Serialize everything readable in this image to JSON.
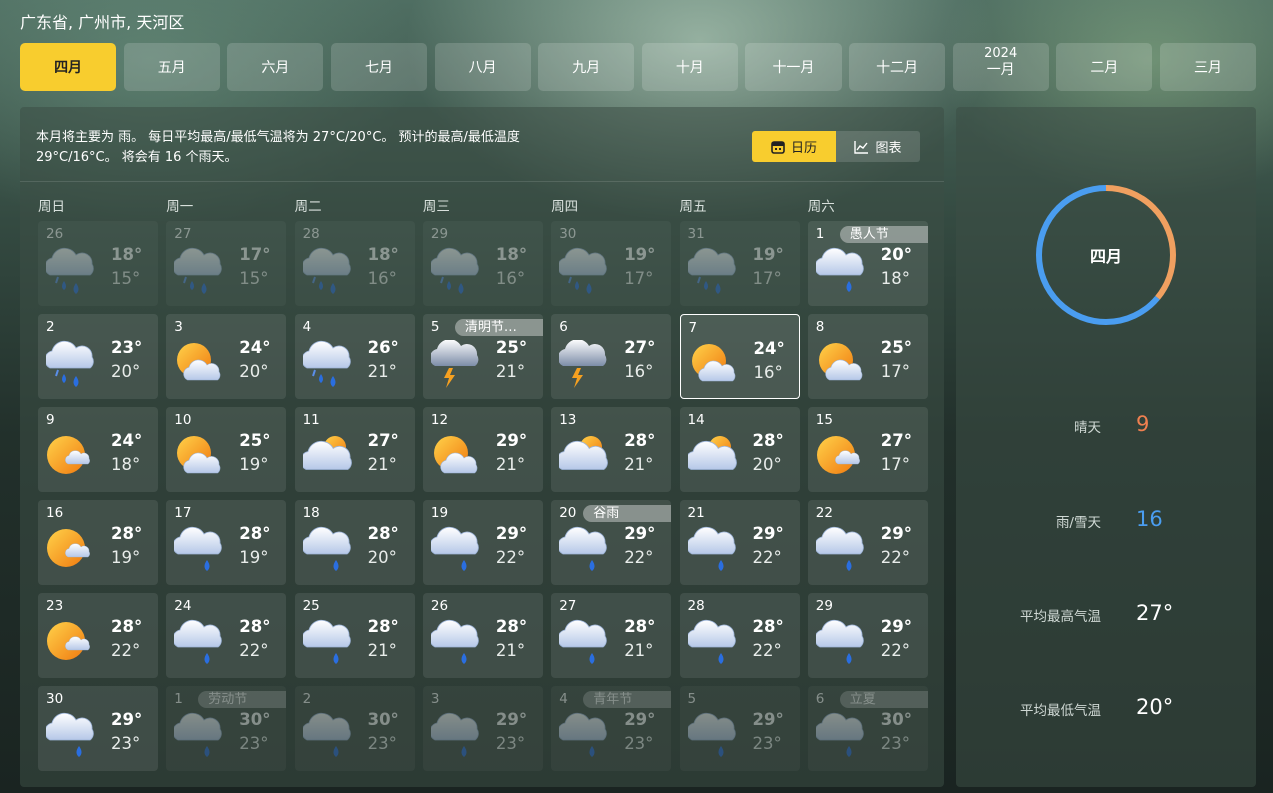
{
  "location": "广东省, 广州市, 天河区",
  "months": [
    {
      "label": "四月",
      "active": true
    },
    {
      "label": "五月"
    },
    {
      "label": "六月"
    },
    {
      "label": "七月"
    },
    {
      "label": "八月"
    },
    {
      "label": "九月"
    },
    {
      "label": "十月"
    },
    {
      "label": "十一月"
    },
    {
      "label": "十二月"
    },
    {
      "label": "一月",
      "year": "2024"
    },
    {
      "label": "二月"
    },
    {
      "label": "三月"
    }
  ],
  "summary": {
    "line1": "本月将主要为 雨。 每日平均最高/最低气温将为 27°C/20°C。 预计的最高/最低温度",
    "line2": "29°C/16°C。 将会有 16 个雨天。"
  },
  "view_toggle": {
    "calendar": "日历",
    "chart": "图表"
  },
  "weekdays": [
    "周日",
    "周一",
    "周二",
    "周三",
    "周四",
    "周五",
    "周六"
  ],
  "days": [
    {
      "d": "26",
      "hi": "18°",
      "lo": "15°",
      "icon": "rain-heavy",
      "faded": true
    },
    {
      "d": "27",
      "hi": "17°",
      "lo": "15°",
      "icon": "rain-heavy",
      "faded": true
    },
    {
      "d": "28",
      "hi": "18°",
      "lo": "16°",
      "icon": "rain-heavy",
      "faded": true
    },
    {
      "d": "29",
      "hi": "18°",
      "lo": "16°",
      "icon": "rain-heavy",
      "faded": true
    },
    {
      "d": "30",
      "hi": "19°",
      "lo": "17°",
      "icon": "rain-heavy",
      "faded": true
    },
    {
      "d": "31",
      "hi": "19°",
      "lo": "17°",
      "icon": "rain-heavy",
      "faded": true
    },
    {
      "d": "1",
      "hi": "20°",
      "lo": "18°",
      "icon": "rain",
      "holiday": "愚人节"
    },
    {
      "d": "2",
      "hi": "23°",
      "lo": "20°",
      "icon": "rain-heavy"
    },
    {
      "d": "3",
      "hi": "24°",
      "lo": "20°",
      "icon": "sun-cloud"
    },
    {
      "d": "4",
      "hi": "26°",
      "lo": "21°",
      "icon": "rain-heavy"
    },
    {
      "d": "5",
      "hi": "25°",
      "lo": "21°",
      "icon": "thunder",
      "holiday": "清明节…"
    },
    {
      "d": "6",
      "hi": "27°",
      "lo": "16°",
      "icon": "thunder"
    },
    {
      "d": "7",
      "hi": "24°",
      "lo": "16°",
      "icon": "sun-cloud",
      "today": true
    },
    {
      "d": "8",
      "hi": "25°",
      "lo": "17°",
      "icon": "sun-cloud"
    },
    {
      "d": "9",
      "hi": "24°",
      "lo": "18°",
      "icon": "sun-small-cloud"
    },
    {
      "d": "10",
      "hi": "25°",
      "lo": "19°",
      "icon": "sun-cloud"
    },
    {
      "d": "11",
      "hi": "27°",
      "lo": "21°",
      "icon": "cloud-sun"
    },
    {
      "d": "12",
      "hi": "29°",
      "lo": "21°",
      "icon": "sun-cloud"
    },
    {
      "d": "13",
      "hi": "28°",
      "lo": "21°",
      "icon": "cloud-sun"
    },
    {
      "d": "14",
      "hi": "28°",
      "lo": "20°",
      "icon": "cloud-sun"
    },
    {
      "d": "15",
      "hi": "27°",
      "lo": "17°",
      "icon": "sun-small-cloud"
    },
    {
      "d": "16",
      "hi": "28°",
      "lo": "19°",
      "icon": "sun-small-cloud"
    },
    {
      "d": "17",
      "hi": "28°",
      "lo": "19°",
      "icon": "rain"
    },
    {
      "d": "18",
      "hi": "28°",
      "lo": "20°",
      "icon": "rain"
    },
    {
      "d": "19",
      "hi": "29°",
      "lo": "22°",
      "icon": "rain"
    },
    {
      "d": "20",
      "hi": "29°",
      "lo": "22°",
      "icon": "rain",
      "holiday": "谷雨"
    },
    {
      "d": "21",
      "hi": "29°",
      "lo": "22°",
      "icon": "rain"
    },
    {
      "d": "22",
      "hi": "29°",
      "lo": "22°",
      "icon": "rain"
    },
    {
      "d": "23",
      "hi": "28°",
      "lo": "22°",
      "icon": "sun-small-cloud"
    },
    {
      "d": "24",
      "hi": "28°",
      "lo": "22°",
      "icon": "rain"
    },
    {
      "d": "25",
      "hi": "28°",
      "lo": "21°",
      "icon": "rain"
    },
    {
      "d": "26",
      "hi": "28°",
      "lo": "21°",
      "icon": "rain"
    },
    {
      "d": "27",
      "hi": "28°",
      "lo": "21°",
      "icon": "rain"
    },
    {
      "d": "28",
      "hi": "28°",
      "lo": "22°",
      "icon": "rain"
    },
    {
      "d": "29",
      "hi": "29°",
      "lo": "22°",
      "icon": "rain"
    },
    {
      "d": "30",
      "hi": "29°",
      "lo": "23°",
      "icon": "rain"
    },
    {
      "d": "1",
      "hi": "30°",
      "lo": "23°",
      "icon": "rain",
      "faded": true,
      "holiday": "劳动节"
    },
    {
      "d": "2",
      "hi": "30°",
      "lo": "23°",
      "icon": "rain",
      "faded": true
    },
    {
      "d": "3",
      "hi": "29°",
      "lo": "23°",
      "icon": "rain",
      "faded": true
    },
    {
      "d": "4",
      "hi": "29°",
      "lo": "23°",
      "icon": "rain",
      "faded": true,
      "holiday": "青年节"
    },
    {
      "d": "5",
      "hi": "29°",
      "lo": "23°",
      "icon": "rain",
      "faded": true
    },
    {
      "d": "6",
      "hi": "30°",
      "lo": "23°",
      "icon": "rain",
      "faded": true,
      "holiday": "立夏"
    }
  ],
  "side": {
    "month_label": "四月",
    "sunny_fraction": 0.36,
    "colors": {
      "sunny": "#f0a060",
      "rain": "#4a9df0"
    },
    "stats": [
      {
        "label": "晴天",
        "value": "9",
        "color": "#f08050"
      },
      {
        "label": "雨/雪天",
        "value": "16",
        "color": "#4a9df0"
      },
      {
        "label": "平均最高气温",
        "value": "27°",
        "color": "#ffffff"
      },
      {
        "label": "平均最低气温",
        "value": "20°",
        "color": "#ffffff"
      }
    ]
  }
}
